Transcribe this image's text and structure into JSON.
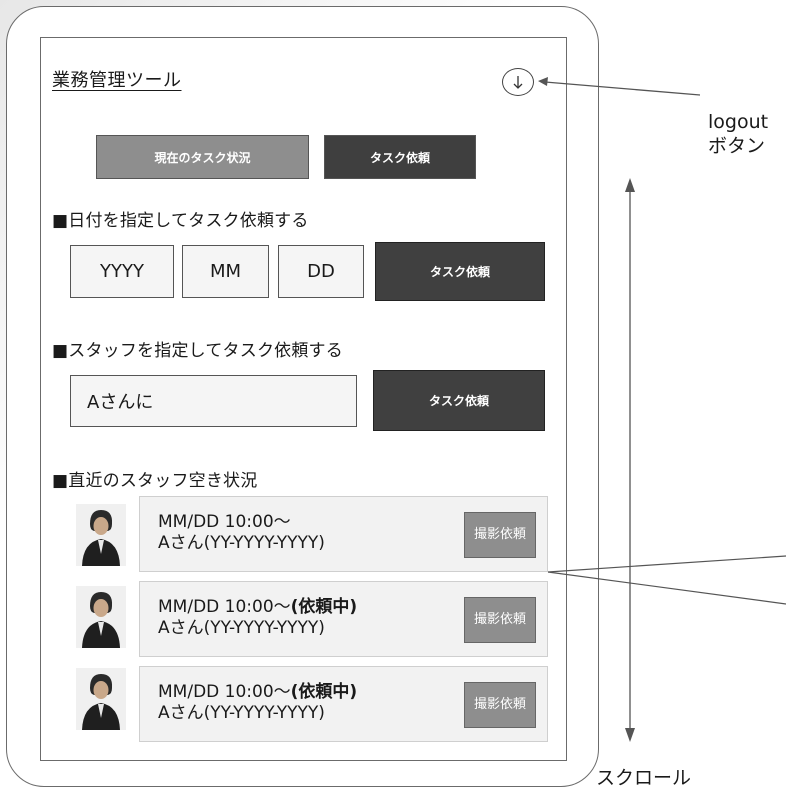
{
  "header": {
    "title": "業務管理ツール",
    "logout_icon": "down-arrow-circle-icon"
  },
  "tabs": [
    {
      "label": "現在のタスク状況"
    },
    {
      "label": "タスク依頼"
    }
  ],
  "date_section": {
    "heading": "■日付を指定してタスク依頼する",
    "year": "YYYY",
    "month": "MM",
    "day": "DD",
    "button_label": "タスク依頼"
  },
  "staff_section": {
    "heading": "■スタッフを指定してタスク依頼する",
    "input_value": "Aさんに",
    "button_label": "タスク依頼"
  },
  "availability_section": {
    "heading": "■直近のスタッフ空き状況",
    "items": [
      {
        "datetime": "MM/DD 10:00〜",
        "status": "",
        "staff": "Aさん(YY-YYYY-YYYY)",
        "button_label": "撮影依頼"
      },
      {
        "datetime": "MM/DD 10:00〜",
        "status": "(依頼中)",
        "staff": "Aさん(YY-YYYY-YYYY)",
        "button_label": "撮影依頼"
      },
      {
        "datetime": "MM/DD 10:00〜",
        "status": "(依頼中)",
        "staff": "Aさん(YY-YYYY-YYYY)",
        "button_label": "撮影依頼"
      }
    ]
  },
  "annotations": {
    "logout_line1": "logout",
    "logout_line2": "ボタン",
    "scroll": "スクロール"
  }
}
